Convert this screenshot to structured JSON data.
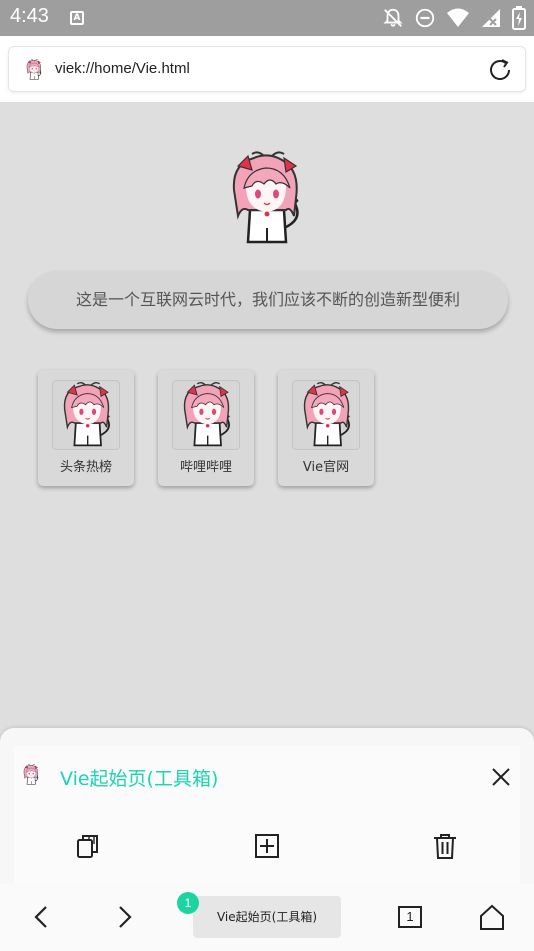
{
  "status": {
    "time": "4:43",
    "notification_icon": "A"
  },
  "browser": {
    "url": "viek://home/Vie.html"
  },
  "home": {
    "slogan": "这是一个互联网云时代，我们应该不断的创造新型便利",
    "shortcuts": [
      {
        "label": "头条热榜"
      },
      {
        "label": "哔哩哔哩"
      },
      {
        "label": "Vie官网"
      }
    ]
  },
  "sheet": {
    "title": "Vie起始页(工具箱)"
  },
  "nav": {
    "tab_badge": "1",
    "tab_title": "Vie起始页(工具箱)",
    "tab_count": "1"
  },
  "colors": {
    "accent": "#1bd4b2",
    "background": "#dedede"
  }
}
